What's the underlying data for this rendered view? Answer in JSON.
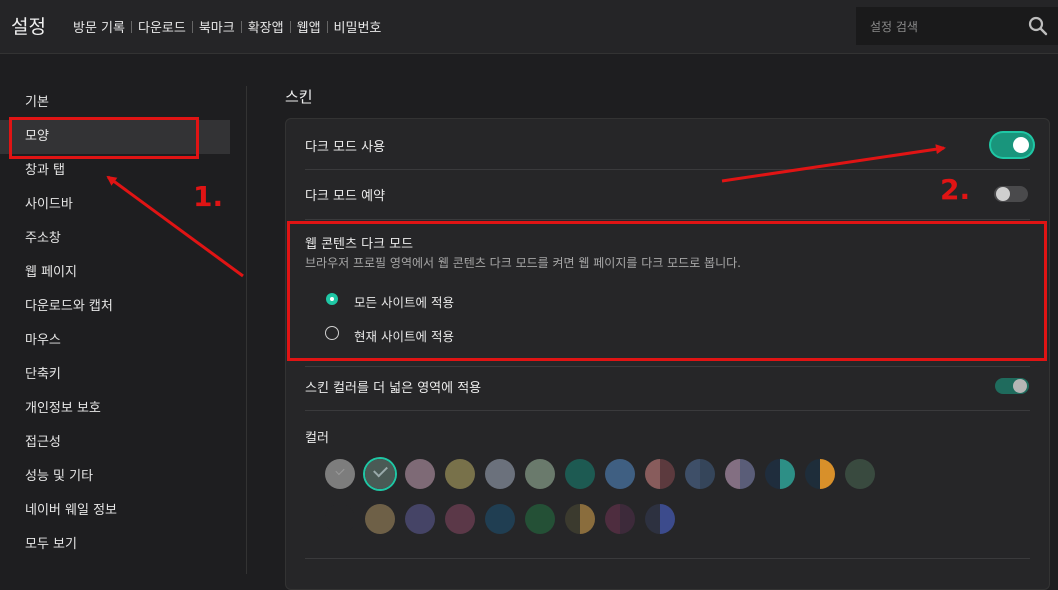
{
  "header": {
    "title": "설정",
    "nav": [
      "방문 기록",
      "다운로드",
      "북마크",
      "확장앱",
      "웹앱",
      "비밀번호"
    ],
    "search_placeholder": "설정 검색"
  },
  "sidebar": {
    "items": [
      "기본",
      "모양",
      "창과 탭",
      "사이드바",
      "주소창",
      "웹 페이지",
      "다운로드와 캡처",
      "마우스",
      "단축키",
      "개인정보 보호",
      "접근성",
      "성능 및 기타",
      "네이버 웨일 정보",
      "모두 보기"
    ],
    "active_index": 1
  },
  "skin": {
    "title": "스킨",
    "dark_mode": {
      "label": "다크 모드 사용",
      "enabled": true
    },
    "dark_mode_schedule": {
      "label": "다크 모드 예약",
      "enabled": false
    },
    "web_content_dark": {
      "title": "웹 콘텐츠 다크 모드",
      "description": "브라우저 프로필 영역에서 웹 콘텐츠 다크 모드를 켜면 웹 페이지를 다크 모드로 봅니다.",
      "options": [
        "모든 사이트에 적용",
        "현재 사이트에 적용"
      ],
      "selected_index": 0
    },
    "wider_color": {
      "label": "스킨 컬러를 더 넓은 영역에 적용",
      "enabled": true
    },
    "color": {
      "label": "컬러",
      "selected_index": 1,
      "swatches": [
        [
          "#7d7d7d",
          "#7d7d7d"
        ],
        [
          "#4a5a55",
          "#4a5a55"
        ],
        [
          "#7e6a76",
          "#7e6a76"
        ],
        [
          "#78714a",
          "#78714a"
        ],
        [
          "#6b717c",
          "#6b717c"
        ],
        [
          "#6a7a6c",
          "#6a7a6c"
        ],
        [
          "#1d5a52",
          "#1d5a52"
        ],
        [
          "#3f5f82",
          "#3f5f82"
        ],
        [
          "#885c5c",
          "#5c3a3e"
        ],
        [
          "#3e4f68",
          "#35455a"
        ],
        [
          "#836f82",
          "#5a5d78"
        ],
        [
          "#1f2d3d",
          "#2d8f86"
        ],
        [
          "#1e2d3a",
          "#d8902a"
        ],
        [
          "#394a3f",
          "#394a3f"
        ],
        [
          "#262628",
          "#262628"
        ],
        [
          "#6e6047",
          "#6e6047"
        ],
        [
          "#454466",
          "#454466"
        ],
        [
          "#5b3848",
          "#5b3848"
        ],
        [
          "#203e52",
          "#203e52"
        ],
        [
          "#245036",
          "#245036"
        ],
        [
          "#3b3a2e",
          "#8a6d3d"
        ],
        [
          "#4e2d3f",
          "#3d2a3a"
        ],
        [
          "#2d3140",
          "#3c4b8c"
        ]
      ]
    }
  },
  "annotations": {
    "first": "1.",
    "second": "2."
  },
  "colors": {
    "accent": "#1fc7a5",
    "annotation": "#e01414",
    "toggle_on": "#1a8f78"
  }
}
